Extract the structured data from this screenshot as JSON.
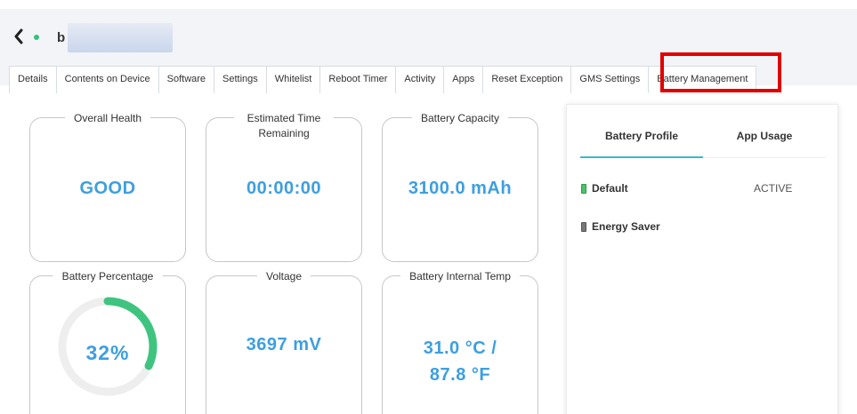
{
  "header": {
    "back_icon": "chevron-left-icon",
    "status_color": "#35c27a",
    "device_name": "b"
  },
  "tabs": [
    {
      "label": "Details"
    },
    {
      "label": "Contents on Device"
    },
    {
      "label": "Software"
    },
    {
      "label": "Settings"
    },
    {
      "label": "Whitelist"
    },
    {
      "label": "Reboot Timer"
    },
    {
      "label": "Activity"
    },
    {
      "label": "Apps"
    },
    {
      "label": "Reset Exception"
    },
    {
      "label": "GMS Settings"
    },
    {
      "label": "Battery Management",
      "active": true
    }
  ],
  "cards": {
    "overall_health": {
      "title": "Overall Health",
      "value": "GOOD"
    },
    "estimated_time": {
      "title": "Estimated Time Remaining",
      "value": "00:00:00"
    },
    "battery_capacity": {
      "title": "Battery Capacity",
      "value": "3100.0 mAh"
    },
    "battery_percentage": {
      "title": "Battery Percentage",
      "value": "32%",
      "percent": 32
    },
    "voltage": {
      "title": "Voltage",
      "value": "3697 mV"
    },
    "internal_temp": {
      "title": "Battery Internal Temp",
      "value_line1": "31.0 °C /",
      "value_line2": "87.8 °F"
    }
  },
  "colors": {
    "accent_blue": "#3d9fe0",
    "gauge_fill": "#3fc480",
    "gauge_track": "#eeeeee",
    "tab_underline": "#3db8c9",
    "highlight_red": "#e00000"
  },
  "panel": {
    "tabs": [
      {
        "label": "Battery Profile",
        "active": true
      },
      {
        "label": "App Usage"
      }
    ],
    "profiles": [
      {
        "name": "Default",
        "status": "ACTIVE",
        "icon": "battery-green-icon"
      },
      {
        "name": "Energy Saver",
        "status": "",
        "icon": "battery-gray-icon"
      }
    ]
  }
}
